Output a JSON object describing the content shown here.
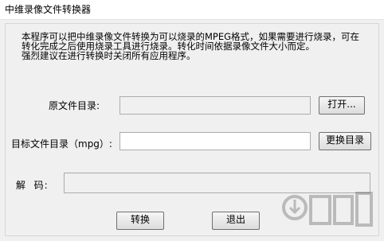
{
  "window": {
    "title": "中维录像文件转换器"
  },
  "description": {
    "lines": [
      "本程序可以把中维录像文件转换为可以烧录的MPEG格式，如果需要进行烧录，可在",
      "转化完成之后使用烧录工具进行烧录。转化时间依据录像文件大小而定。",
      "强烈建议在进行转换时关闭所有应用程序。"
    ]
  },
  "source": {
    "label": "原文件目录:",
    "value": "",
    "open_button": "打开..."
  },
  "target": {
    "label": "目标文件目录（mpg）:",
    "value": "",
    "change_button": "更换目录"
  },
  "decode": {
    "label": "解  码:",
    "value": ""
  },
  "actions": {
    "convert": "转换",
    "exit": "退出"
  },
  "watermark": {
    "text": "下载吧",
    "icon": "download-site-watermark"
  }
}
